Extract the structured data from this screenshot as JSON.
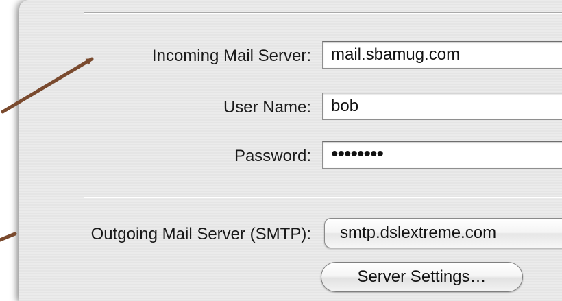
{
  "incoming": {
    "label": "Incoming Mail Server:",
    "value": "mail.sbamug.com"
  },
  "username": {
    "label": "User Name:",
    "value": "bob"
  },
  "password": {
    "label": "Password:",
    "value": "••••••••"
  },
  "outgoing": {
    "label": "Outgoing Mail Server (SMTP):",
    "selected": "smtp.dslextreme.com"
  },
  "server_settings_button": {
    "label": "Server Settings…"
  },
  "annotation": {
    "arrow_color": "#7a4a2e"
  }
}
